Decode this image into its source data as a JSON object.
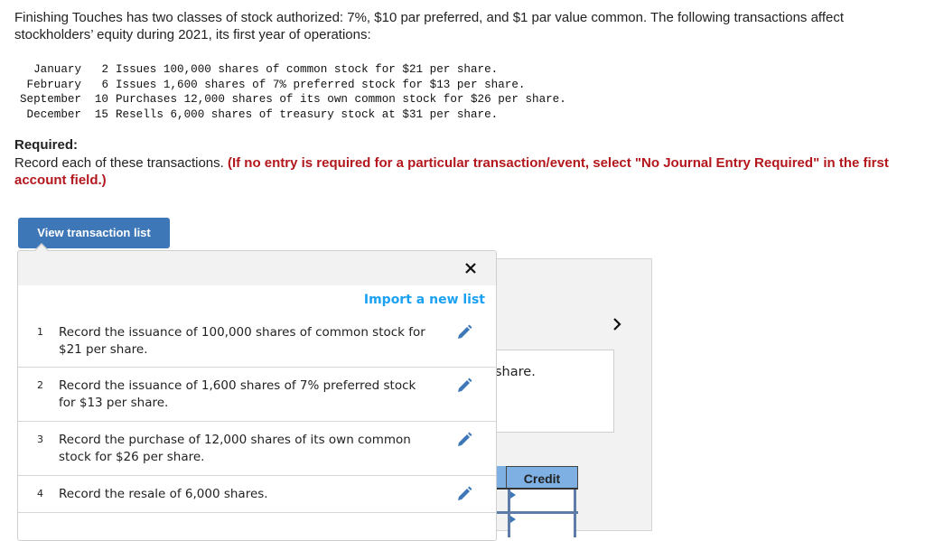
{
  "problem": {
    "intro": "Finishing Touches has two classes of stock authorized: 7%, $10 par preferred, and $1 par value common. The following transactions affect stockholders’ equity during 2021, its first year of operations:",
    "transactions": [
      {
        "month": "January",
        "day": "2",
        "text": "Issues 100,000 shares of common stock for $21 per share."
      },
      {
        "month": "February",
        "day": "6",
        "text": "Issues 1,600 shares of 7% preferred stock for $13 per share."
      },
      {
        "month": "September",
        "day": "10",
        "text": "Purchases 12,000 shares of its own common stock for $26 per share."
      },
      {
        "month": "December",
        "day": "15",
        "text": "Resells 6,000 shares of treasury stock at $31 per share."
      }
    ],
    "required_label": "Required:",
    "required_text": "Record each of these transactions.",
    "required_warning": "(If no entry is required for a particular transaction/event, select \"No Journal Entry Required\" in the first account field.)"
  },
  "toolbar": {
    "view_transaction_list_label": "View transaction list"
  },
  "popover": {
    "close_label": "×",
    "import_label": "Import a new list",
    "items": [
      {
        "number": "1",
        "text": "Record the issuance of 100,000 shares of common stock for $21 per share."
      },
      {
        "number": "2",
        "text": "Record the issuance of 1,600 shares of 7% preferred stock for $13 per share."
      },
      {
        "number": "3",
        "text": "Record the purchase of 12,000 shares of its own common stock for $26 per share."
      },
      {
        "number": "4",
        "text": "Record the resale of 6,000 shares."
      }
    ]
  },
  "background": {
    "question_fragment": "share.",
    "credit_header": "Credit",
    "icons": {
      "next": "chevron-right-icon",
      "edit": "pencil-icon",
      "close": "close-icon"
    }
  },
  "colors": {
    "button_blue": "#3d77b8",
    "link_blue": "#1ba1f2",
    "warning_red": "#b3171d",
    "table_header_blue": "#7fb0e3"
  }
}
